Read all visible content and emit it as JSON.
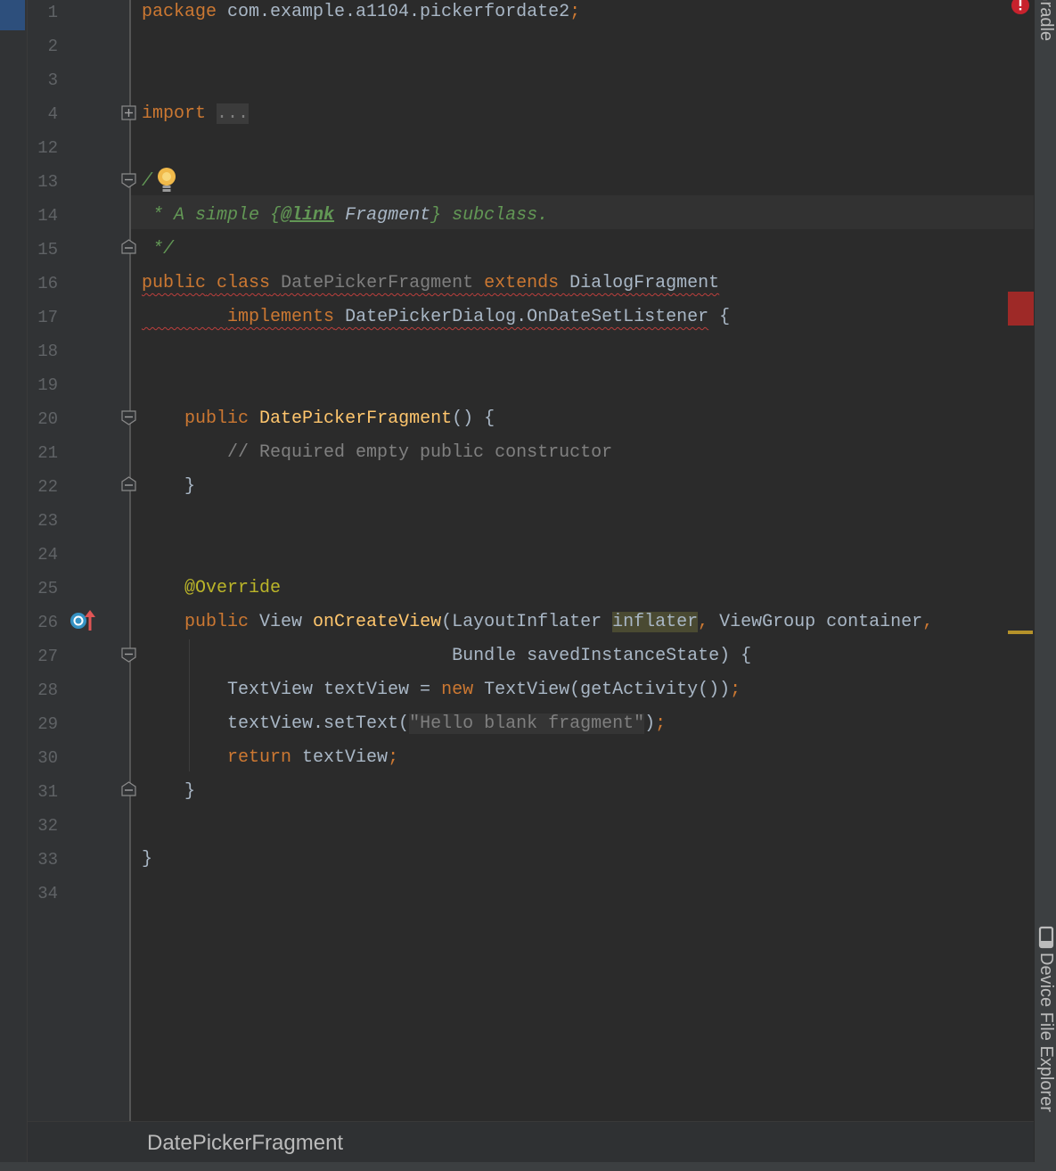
{
  "editor": {
    "line_numbers": [
      "1",
      "2",
      "3",
      "4",
      "12",
      "13",
      "14",
      "15",
      "16",
      "17",
      "18",
      "19",
      "20",
      "21",
      "22",
      "23",
      "24",
      "25",
      "26",
      "27",
      "28",
      "29",
      "30",
      "31",
      "32",
      "33",
      "34"
    ],
    "tokens": {
      "l1_kw": "package",
      "l1_rest": " com.example.a1104.pickerfordate2",
      "semi": ";",
      "l4_kw": "import",
      "l4_fold": "...",
      "l13_start": "/",
      "l14_star": " * A simple ",
      "l14_brace_open": "{",
      "l14_tag": "@link",
      "l14_ref": " Fragment",
      "l14_brace_close": "}",
      "l14_end": " subclass.",
      "l15": " */",
      "l16_kw1": "public",
      "l16_kw2": "class",
      "l16_name": "DatePickerFragment",
      "l16_kw3": "extends",
      "l16_super": "DialogFragment",
      "l17_kw": "implements",
      "l17_iface": "DatePickerDialog.OnDateSetListener",
      "l17_brace": " {",
      "l20_kw": "public",
      "l20_fn": "DatePickerFragment",
      "l20_rest": "() {",
      "l21_comment": "// Required empty public constructor",
      "close_brace": "}",
      "l25_ann": "@Override",
      "l26_kw": "public",
      "l26_type": " View ",
      "l26_fn": "onCreateView",
      "l26_p1": "(LayoutInflater ",
      "l26_param": "inflater",
      "comma": ",",
      "l26_p2": " ViewGroup container",
      "l27_rest": "Bundle savedInstanceState) {",
      "l28_a": "TextView textView = ",
      "l28_kw": "new",
      "l28_b": " TextView(getActivity())",
      "l29_a": "textView.setText(",
      "l29_str": "\"Hello blank fragment\"",
      "l29_b": ")",
      "l30_kw": "return",
      "l30_rest": " textView"
    }
  },
  "right_tools": {
    "gradle": "Gradle",
    "device_file_explorer": "Device File Explorer"
  },
  "breadcrumb": {
    "label": "DatePickerFragment"
  },
  "colors": {
    "background": "#2b2b2b",
    "keyword": "#cc7832",
    "function": "#ffc66d",
    "annotation": "#bbb529",
    "comment": "#808080",
    "doc_comment": "#629755",
    "string": "#6a8759",
    "error": "#bc3f3c"
  }
}
